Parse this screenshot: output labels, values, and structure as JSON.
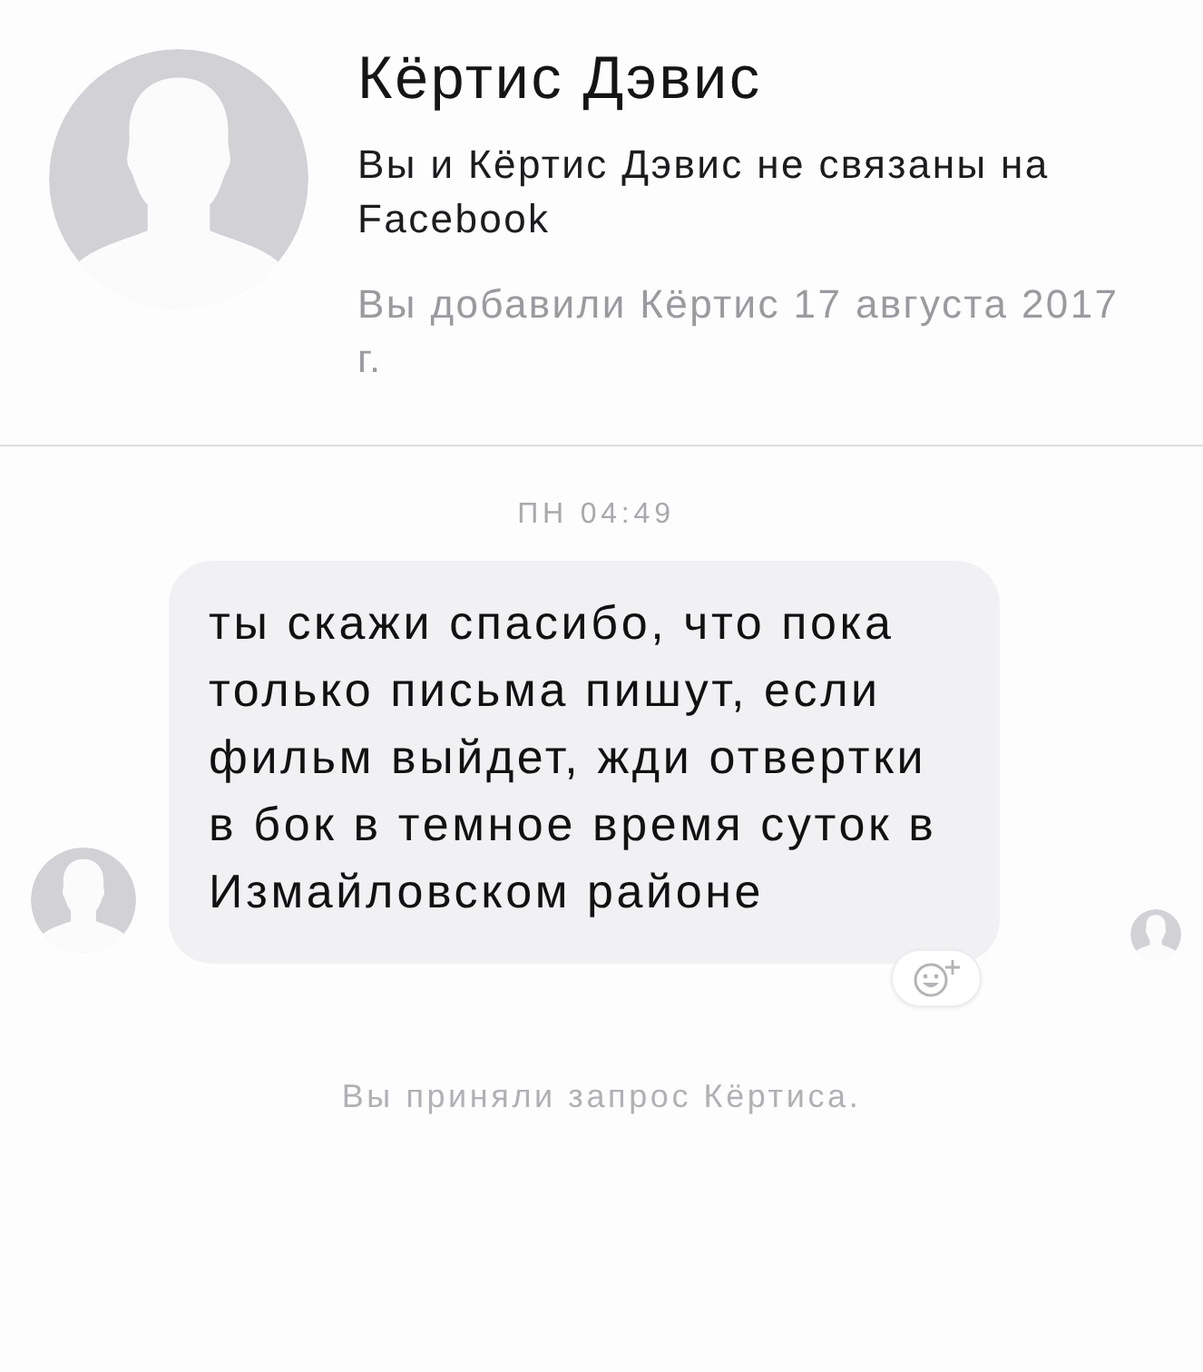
{
  "contact": {
    "name": "Кёртис Дэвис",
    "connection_note": "Вы и Кёртис Дэвис не связаны на Facebook",
    "added_note": "Вы добавили Кёртис 17 августа 2017 г."
  },
  "conversation": {
    "timestamp": "ПН 04:49",
    "messages": [
      {
        "text": "ты скажи спасибо, что пока только письма пишут, если фильм выйдет, жди отвертки в бок в темное время суток в Измайловском районе",
        "read": true
      }
    ],
    "system_notice": "Вы приняли запрос Кёртиса."
  }
}
